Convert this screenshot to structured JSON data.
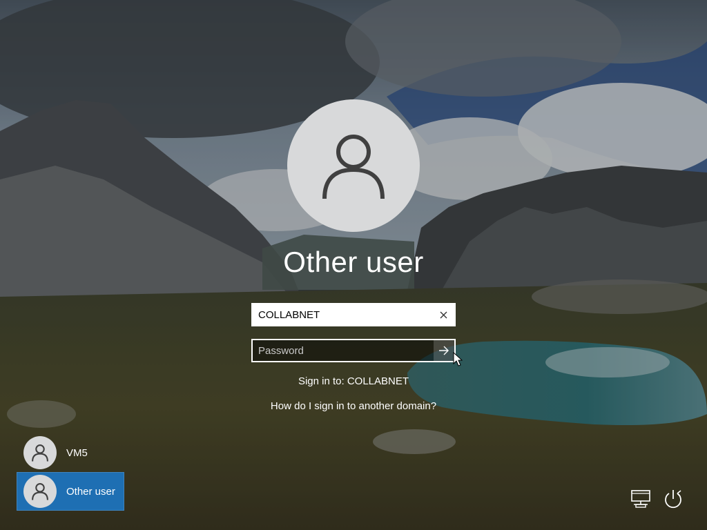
{
  "login": {
    "title": "Other user",
    "username_value": "COLLABNET",
    "password_placeholder": "Password",
    "sign_in_to": "Sign in to: COLLABNET",
    "domain_help_link": "How do I sign in to another domain?"
  },
  "users": [
    {
      "name": "VM5",
      "selected": false
    },
    {
      "name": "Other user",
      "selected": true
    }
  ],
  "icons": {
    "large_avatar": "user-icon",
    "clear": "close-icon",
    "submit": "arrow-right-icon",
    "network": "network-icon",
    "power": "power-icon"
  },
  "colors": {
    "selected_user_bg": "#1e6fb3",
    "avatar_bg": "#d8d9da",
    "text": "#ffffff"
  }
}
